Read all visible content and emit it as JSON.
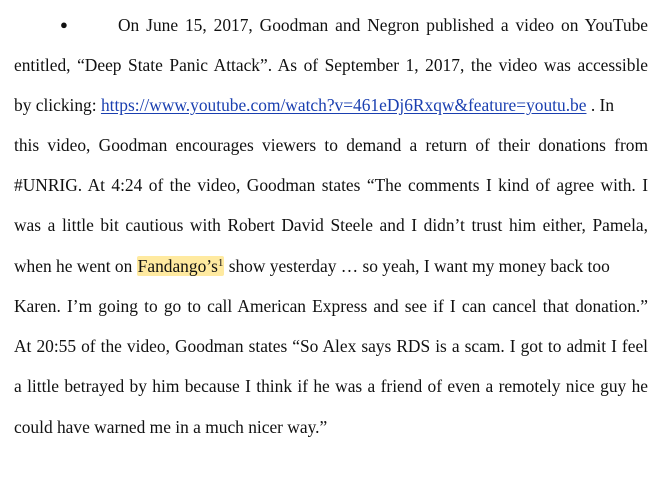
{
  "paragraph": {
    "bullet": "●",
    "line1": "On June 15, 2017, Goodman and Negron published a video on YouTube",
    "line2": "entitled, “Deep State Panic Attack”.  As of September 1, 2017, the video was accessible",
    "line3_pre": "by clicking: ",
    "link": "https://www.youtube.com/watch?v=461eDj6Rxqw&feature=youtu.be",
    "line3_post": ".    In",
    "line4": "this video, Goodman encourages viewers to demand a return of their donations from",
    "line5": "#UNRIG.  At 4:24 of the video, Goodman states “The comments I kind of agree with.  I",
    "line6": "was a little bit cautious with Robert David Steele and I didn’t trust him either, Pamela,",
    "line7_pre": "when he went on ",
    "highlight": "Fandango’s",
    "footnote": "1",
    "line7_post": " show yesterday … so yeah, I want my money back too",
    "line8": "Karen.  I’m going to go to call American Express and see if I can cancel that donation.”",
    "line9": "At 20:55 of the video, Goodman states “So Alex says RDS is a scam.  I got to admit I feel",
    "line10": "a little betrayed by him because I think if he was a friend of even a remotely nice guy he",
    "line11": "could have warned me in a much nicer way.”"
  },
  "colors": {
    "link": "#1a3fb0",
    "highlight": "#ffeaa0",
    "text": "#111111"
  }
}
